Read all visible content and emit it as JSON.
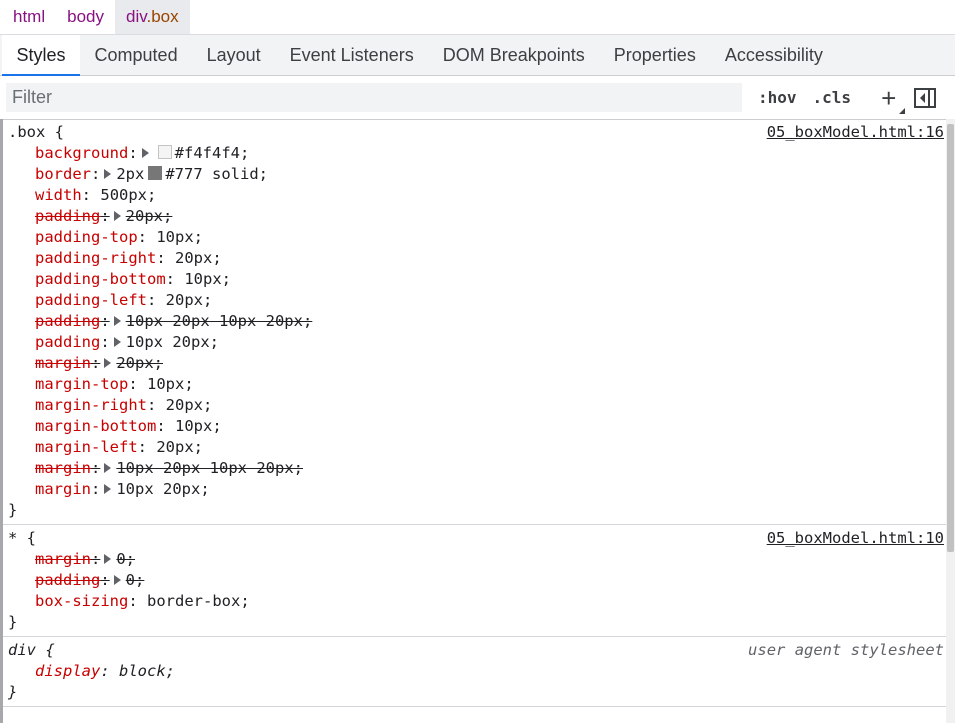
{
  "breadcrumbs": [
    {
      "tag": "html",
      "cls": ""
    },
    {
      "tag": "body",
      "cls": ""
    },
    {
      "tag": "div",
      "cls": ".box"
    }
  ],
  "tabs": [
    "Styles",
    "Computed",
    "Layout",
    "Event Listeners",
    "DOM Breakpoints",
    "Properties",
    "Accessibility"
  ],
  "filter": {
    "placeholder": "Filter",
    "value": ""
  },
  "toolbar": {
    "hov": ":hov",
    "cls": ".cls",
    "plus": "+"
  },
  "colors": {
    "accent": "#1a73e8",
    "property": "#c80000",
    "swatch_bg": "#f4f4f4",
    "swatch_border": "#777777"
  },
  "rules": [
    {
      "selector": ".box {",
      "source": "05_boxModel.html:16",
      "close": "}",
      "decls": [
        {
          "prop": "background",
          "val": "#f4f4f4;",
          "expander": true,
          "swatch": "#f4f4f4",
          "over": false
        },
        {
          "prop": "border",
          "val": "2px",
          "val2": "#777 solid;",
          "expander": true,
          "swatch": "#777777",
          "over": false
        },
        {
          "prop": "width",
          "val": "500px;",
          "over": false
        },
        {
          "prop": "padding",
          "val": "20px;",
          "expander": true,
          "over": true
        },
        {
          "prop": "padding-top",
          "val": "10px;",
          "over": false
        },
        {
          "prop": "padding-right",
          "val": "20px;",
          "over": false
        },
        {
          "prop": "padding-bottom",
          "val": "10px;",
          "over": false
        },
        {
          "prop": "padding-left",
          "val": "20px;",
          "over": false
        },
        {
          "prop": "padding",
          "val": "10px 20px 10px 20px;",
          "expander": true,
          "over": true
        },
        {
          "prop": "padding",
          "val": "10px 20px;",
          "expander": true,
          "over": false
        },
        {
          "prop": "margin",
          "val": "20px;",
          "expander": true,
          "over": true
        },
        {
          "prop": "margin-top",
          "val": "10px;",
          "over": false
        },
        {
          "prop": "margin-right",
          "val": "20px;",
          "over": false
        },
        {
          "prop": "margin-bottom",
          "val": "10px;",
          "over": false
        },
        {
          "prop": "margin-left",
          "val": "20px;",
          "over": false
        },
        {
          "prop": "margin",
          "val": "10px 20px 10px 20px;",
          "expander": true,
          "over": true
        },
        {
          "prop": "margin",
          "val": "10px 20px;",
          "expander": true,
          "over": false
        }
      ]
    },
    {
      "selector": "* {",
      "source": "05_boxModel.html:10",
      "close": "}",
      "decls": [
        {
          "prop": "margin",
          "val": "0;",
          "expander": true,
          "over": true
        },
        {
          "prop": "padding",
          "val": "0;",
          "expander": true,
          "over": true
        },
        {
          "prop": "box-sizing",
          "val": "border-box;",
          "over": false
        }
      ]
    },
    {
      "selector": "div {",
      "source": "user agent stylesheet",
      "ua": true,
      "close": "}",
      "decls": [
        {
          "prop": "display",
          "val": "block;",
          "over": false
        }
      ]
    }
  ]
}
